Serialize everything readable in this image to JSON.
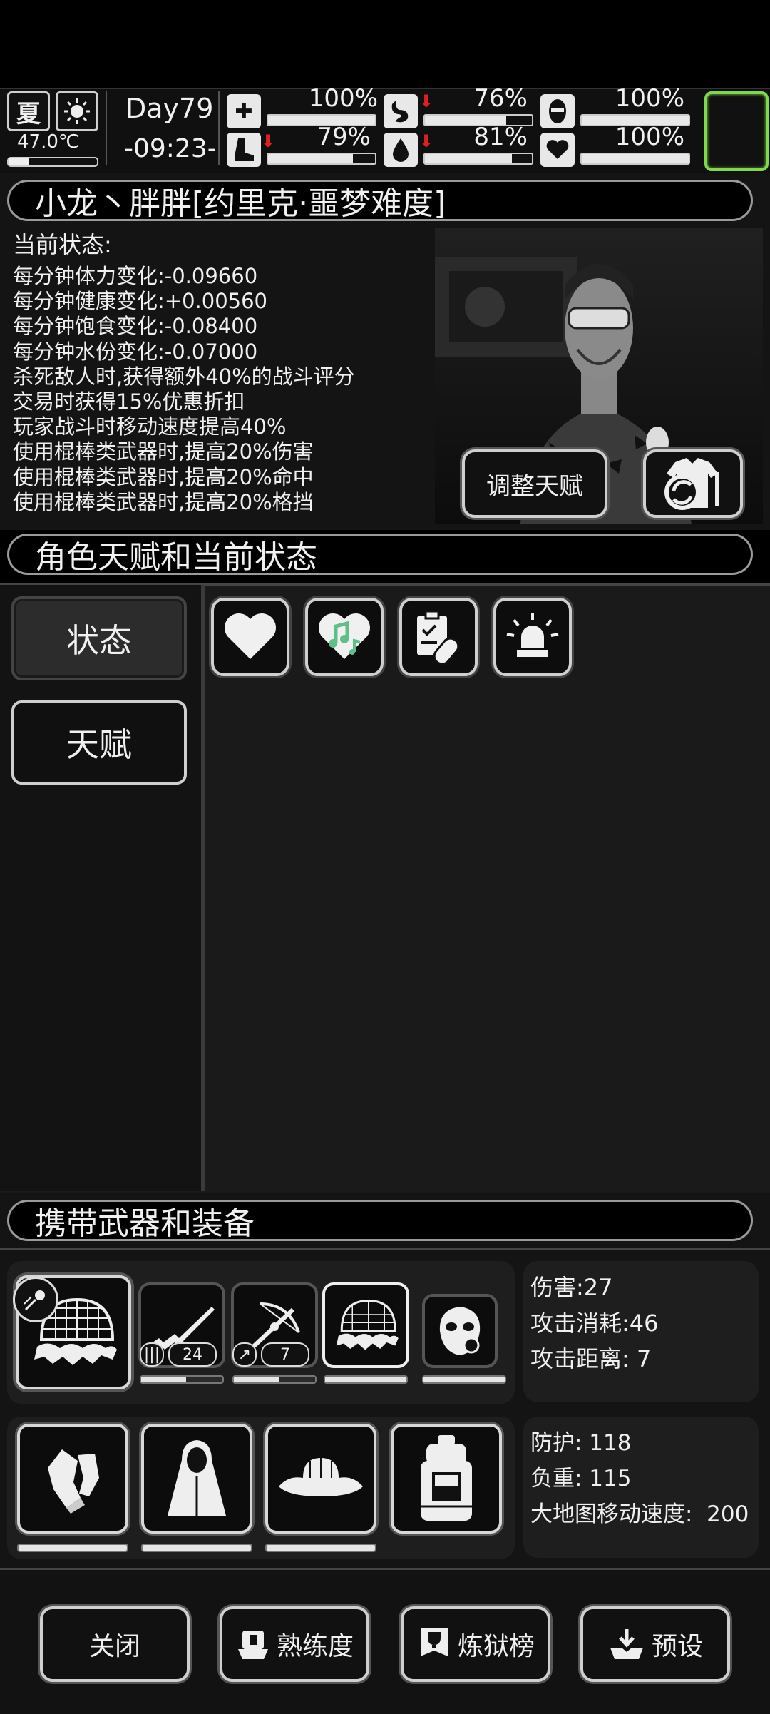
{
  "topbar": {
    "season": "夏",
    "temperature": "47.0℃",
    "day": "Day79",
    "time": "-09:23-",
    "stats": [
      {
        "name": "health",
        "value": "100%",
        "fraction": 1.0,
        "icon": "medkit-icon",
        "down": false
      },
      {
        "name": "hunger",
        "value": "76%",
        "fraction": 0.76,
        "icon": "stomach-icon",
        "down": true
      },
      {
        "name": "mood",
        "value": "100%",
        "fraction": 1.0,
        "icon": "mask-icon",
        "down": false
      },
      {
        "name": "stamina",
        "value": "79%",
        "fraction": 0.79,
        "icon": "boot-icon",
        "down": true
      },
      {
        "name": "water",
        "value": "81%",
        "fraction": 0.81,
        "icon": "water-drop-icon",
        "down": true
      },
      {
        "name": "vitality",
        "value": "100%",
        "fraction": 1.0,
        "icon": "heart-icon",
        "down": false
      }
    ]
  },
  "character": {
    "title": "小龙丶胖胖[约里克·噩梦难度]",
    "status_heading": "当前状态:",
    "status_lines": [
      "每分钟体力变化:-0.09660",
      "每分钟健康变化:+0.00560",
      "每分钟饱食变化:-0.08400",
      "每分钟水份变化:-0.07000",
      "杀死敌人时,获得额外40%的战斗评分",
      "交易时获得15%优惠折扣",
      "玩家战斗时移动速度提高40%",
      "使用棍棒类武器时,提高20%伤害",
      "使用棍棒类武器时,提高20%命中",
      "使用棍棒类武器时,提高20%格挡"
    ],
    "adjust_talent_label": "调整天赋"
  },
  "talents": {
    "header": "角色天赋和当前状态",
    "tabs": [
      "状态",
      "天赋"
    ],
    "status_icons": [
      "heart-icon",
      "music-heart-icon",
      "clipboard-pill-icon",
      "alarm-light-icon"
    ]
  },
  "equipment": {
    "header": "携带武器和装备",
    "weapons": [
      {
        "icon": "net-trap-icon",
        "count": null,
        "durability": 1.0
      },
      {
        "icon": "rifle-icon",
        "count": "24",
        "durability": 0.55
      },
      {
        "icon": "crossbow-icon",
        "count": "7",
        "durability": 0.55
      },
      {
        "icon": "net-trap-icon",
        "count": null,
        "durability": 1.0
      },
      {
        "icon": "gas-mask-icon",
        "count": null,
        "durability": 1.0
      }
    ],
    "weapon_stats": [
      {
        "label": "伤害:",
        "value": "27"
      },
      {
        "label": "攻击消耗:",
        "value": "46"
      },
      {
        "label": "攻击距离:",
        "value": " 7"
      }
    ],
    "armor": [
      {
        "icon": "gloves-icon",
        "durability": 1.0
      },
      {
        "icon": "cloak-icon",
        "durability": 1.0
      },
      {
        "icon": "straw-hat-icon",
        "durability": 1.0
      },
      {
        "icon": "backpack-icon",
        "durability": null
      }
    ],
    "armor_stats": [
      {
        "label": "防护:",
        "value": " 118"
      },
      {
        "label": "负重:",
        "value": " 115"
      },
      {
        "label": "大地图移动速度:",
        "value": "  200"
      }
    ]
  },
  "bottom": {
    "close": "关闭",
    "proficiency": "熟练度",
    "ranking": "炼狱榜",
    "preset": "预设"
  }
}
